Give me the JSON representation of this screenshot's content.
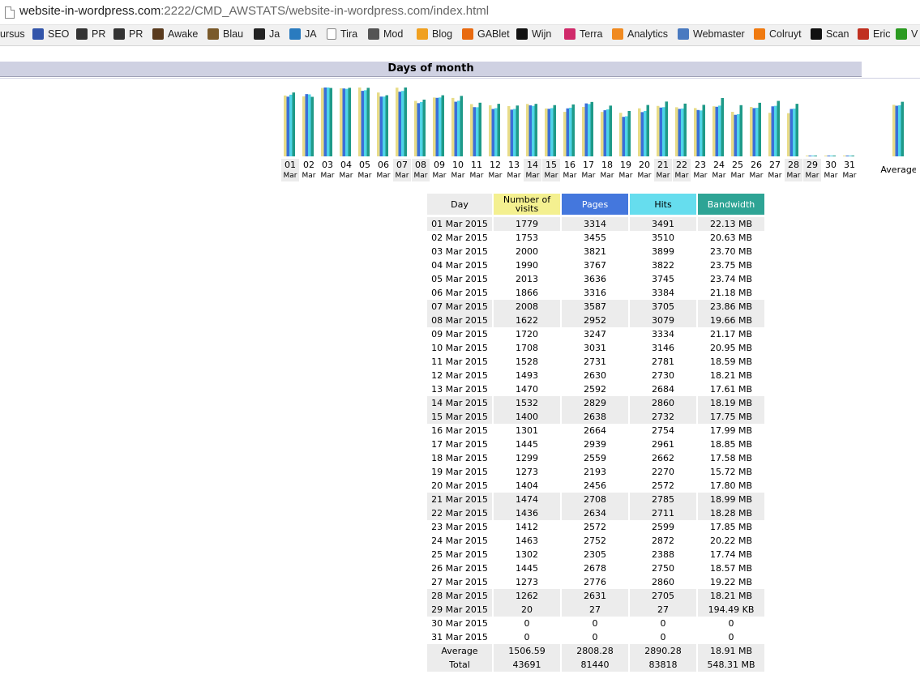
{
  "browser": {
    "url_host": "website-in-wordpress.com",
    "url_rest": ":2222/CMD_AWSTATS/website-in-wordpress.com/index.html",
    "bookmarks": [
      {
        "label": "ursus",
        "icon": "none"
      },
      {
        "label": "SEO",
        "icon": "mb-icon"
      },
      {
        "label": "PR",
        "icon": "pr-icon"
      },
      {
        "label": "PR",
        "icon": "pb-icon"
      },
      {
        "label": "Awake",
        "icon": "awake-icon"
      },
      {
        "label": "Blau",
        "icon": "blau-icon"
      },
      {
        "label": "Ja",
        "icon": "joomla-icon"
      },
      {
        "label": "JA",
        "icon": "ja-icon"
      },
      {
        "label": "Tira",
        "icon": "page-icon"
      },
      {
        "label": "Mod",
        "icon": "mod-icon"
      },
      {
        "label": "Blog",
        "icon": "blog-icon"
      },
      {
        "label": "GABlet",
        "icon": "gablet-icon"
      },
      {
        "label": "Wijn",
        "icon": "wijn-icon"
      },
      {
        "label": "Terra",
        "icon": "terra-icon"
      },
      {
        "label": "Analytics",
        "icon": "analytics-icon"
      },
      {
        "label": "Webmaster",
        "icon": "webmaster-icon"
      },
      {
        "label": "Colruyt",
        "icon": "colruyt-icon"
      },
      {
        "label": "Scan",
        "icon": "scan-icon"
      },
      {
        "label": "Eric",
        "icon": "eric-icon"
      },
      {
        "label": "V",
        "icon": "v-icon"
      }
    ]
  },
  "section_title": "Days of month",
  "colors": {
    "visits": "#e8dc88",
    "pages": "#3a6fd8",
    "hits": "#4fd4e8",
    "bandwidth": "#1f9a88",
    "weekend_bg": "#ececec",
    "title_bg": "#cfd1e2"
  },
  "table": {
    "headers": {
      "day": "Day",
      "visits": "Number of visits",
      "pages": "Pages",
      "hits": "Hits",
      "bandwidth": "Bandwidth"
    },
    "rows": [
      {
        "day": "01 Mar 2015",
        "visits": "1779",
        "pages": "3314",
        "hits": "3491",
        "bandwidth": "22.13 MB"
      },
      {
        "day": "02 Mar 2015",
        "visits": "1753",
        "pages": "3455",
        "hits": "3510",
        "bandwidth": "20.63 MB"
      },
      {
        "day": "03 Mar 2015",
        "visits": "2000",
        "pages": "3821",
        "hits": "3899",
        "bandwidth": "23.70 MB"
      },
      {
        "day": "04 Mar 2015",
        "visits": "1990",
        "pages": "3767",
        "hits": "3822",
        "bandwidth": "23.75 MB"
      },
      {
        "day": "05 Mar 2015",
        "visits": "2013",
        "pages": "3636",
        "hits": "3745",
        "bandwidth": "23.74 MB"
      },
      {
        "day": "06 Mar 2015",
        "visits": "1866",
        "pages": "3316",
        "hits": "3384",
        "bandwidth": "21.18 MB"
      },
      {
        "day": "07 Mar 2015",
        "visits": "2008",
        "pages": "3587",
        "hits": "3705",
        "bandwidth": "23.86 MB"
      },
      {
        "day": "08 Mar 2015",
        "visits": "1622",
        "pages": "2952",
        "hits": "3079",
        "bandwidth": "19.66 MB"
      },
      {
        "day": "09 Mar 2015",
        "visits": "1720",
        "pages": "3247",
        "hits": "3334",
        "bandwidth": "21.17 MB"
      },
      {
        "day": "10 Mar 2015",
        "visits": "1708",
        "pages": "3031",
        "hits": "3146",
        "bandwidth": "20.95 MB"
      },
      {
        "day": "11 Mar 2015",
        "visits": "1528",
        "pages": "2731",
        "hits": "2781",
        "bandwidth": "18.59 MB"
      },
      {
        "day": "12 Mar 2015",
        "visits": "1493",
        "pages": "2630",
        "hits": "2730",
        "bandwidth": "18.21 MB"
      },
      {
        "day": "13 Mar 2015",
        "visits": "1470",
        "pages": "2592",
        "hits": "2684",
        "bandwidth": "17.61 MB"
      },
      {
        "day": "14 Mar 2015",
        "visits": "1532",
        "pages": "2829",
        "hits": "2860",
        "bandwidth": "18.19 MB"
      },
      {
        "day": "15 Mar 2015",
        "visits": "1400",
        "pages": "2638",
        "hits": "2732",
        "bandwidth": "17.75 MB"
      },
      {
        "day": "16 Mar 2015",
        "visits": "1301",
        "pages": "2664",
        "hits": "2754",
        "bandwidth": "17.99 MB"
      },
      {
        "day": "17 Mar 2015",
        "visits": "1445",
        "pages": "2939",
        "hits": "2961",
        "bandwidth": "18.85 MB"
      },
      {
        "day": "18 Mar 2015",
        "visits": "1299",
        "pages": "2559",
        "hits": "2662",
        "bandwidth": "17.58 MB"
      },
      {
        "day": "19 Mar 2015",
        "visits": "1273",
        "pages": "2193",
        "hits": "2270",
        "bandwidth": "15.72 MB"
      },
      {
        "day": "20 Mar 2015",
        "visits": "1404",
        "pages": "2456",
        "hits": "2572",
        "bandwidth": "17.80 MB"
      },
      {
        "day": "21 Mar 2015",
        "visits": "1474",
        "pages": "2708",
        "hits": "2785",
        "bandwidth": "18.99 MB"
      },
      {
        "day": "22 Mar 2015",
        "visits": "1436",
        "pages": "2634",
        "hits": "2711",
        "bandwidth": "18.28 MB"
      },
      {
        "day": "23 Mar 2015",
        "visits": "1412",
        "pages": "2572",
        "hits": "2599",
        "bandwidth": "17.85 MB"
      },
      {
        "day": "24 Mar 2015",
        "visits": "1463",
        "pages": "2752",
        "hits": "2872",
        "bandwidth": "20.22 MB"
      },
      {
        "day": "25 Mar 2015",
        "visits": "1302",
        "pages": "2305",
        "hits": "2388",
        "bandwidth": "17.74 MB"
      },
      {
        "day": "26 Mar 2015",
        "visits": "1445",
        "pages": "2678",
        "hits": "2750",
        "bandwidth": "18.57 MB"
      },
      {
        "day": "27 Mar 2015",
        "visits": "1273",
        "pages": "2776",
        "hits": "2860",
        "bandwidth": "19.22 MB"
      },
      {
        "day": "28 Mar 2015",
        "visits": "1262",
        "pages": "2631",
        "hits": "2705",
        "bandwidth": "18.21 MB"
      },
      {
        "day": "29 Mar 2015",
        "visits": "20",
        "pages": "27",
        "hits": "27",
        "bandwidth": "194.49 KB"
      },
      {
        "day": "30 Mar 2015",
        "visits": "0",
        "pages": "0",
        "hits": "0",
        "bandwidth": "0"
      },
      {
        "day": "31 Mar 2015",
        "visits": "0",
        "pages": "0",
        "hits": "0",
        "bandwidth": "0"
      }
    ],
    "average": {
      "label": "Average",
      "visits": "1506.59",
      "pages": "2808.28",
      "hits": "2890.28",
      "bandwidth": "18.91 MB"
    },
    "total": {
      "label": "Total",
      "visits": "43691",
      "pages": "81440",
      "hits": "83818",
      "bandwidth": "548.31 MB"
    }
  },
  "chart_data": {
    "type": "bar",
    "categories": [
      "01",
      "02",
      "03",
      "04",
      "05",
      "06",
      "07",
      "08",
      "09",
      "10",
      "11",
      "12",
      "13",
      "14",
      "15",
      "16",
      "17",
      "18",
      "19",
      "20",
      "21",
      "22",
      "23",
      "24",
      "25",
      "26",
      "27",
      "28",
      "29",
      "30",
      "31"
    ],
    "category_sublabel": "Mar",
    "weekend_days": [
      "01",
      "07",
      "08",
      "14",
      "15",
      "21",
      "22",
      "28",
      "29"
    ],
    "extra_category": "Average",
    "series": [
      {
        "key": "visits",
        "values": [
          1779,
          1753,
          2000,
          1990,
          2013,
          1866,
          2008,
          1622,
          1720,
          1708,
          1528,
          1493,
          1470,
          1532,
          1400,
          1301,
          1445,
          1299,
          1273,
          1404,
          1474,
          1436,
          1412,
          1463,
          1302,
          1445,
          1273,
          1262,
          20,
          0,
          0
        ],
        "average": 1506.59
      },
      {
        "key": "pages",
        "values": [
          3314,
          3455,
          3821,
          3767,
          3636,
          3316,
          3587,
          2952,
          3247,
          3031,
          2731,
          2630,
          2592,
          2829,
          2638,
          2664,
          2939,
          2559,
          2193,
          2456,
          2708,
          2634,
          2572,
          2752,
          2305,
          2678,
          2776,
          2631,
          27,
          0,
          0
        ],
        "average": 2808.28
      },
      {
        "key": "hits",
        "values": [
          3491,
          3510,
          3899,
          3822,
          3745,
          3384,
          3705,
          3079,
          3334,
          3146,
          2781,
          2730,
          2684,
          2860,
          2732,
          2754,
          2961,
          2662,
          2270,
          2572,
          2785,
          2711,
          2599,
          2872,
          2388,
          2750,
          2860,
          2705,
          27,
          0,
          0
        ],
        "average": 2890.28
      },
      {
        "key": "bandwidth_mb",
        "values": [
          22.13,
          20.63,
          23.7,
          23.75,
          23.74,
          21.18,
          23.86,
          19.66,
          21.17,
          20.95,
          18.59,
          18.21,
          17.61,
          18.19,
          17.75,
          17.99,
          18.85,
          17.58,
          15.72,
          17.8,
          18.99,
          18.28,
          17.85,
          20.22,
          17.74,
          18.57,
          19.22,
          18.21,
          0.19,
          0,
          0
        ],
        "average": 18.91
      }
    ]
  }
}
